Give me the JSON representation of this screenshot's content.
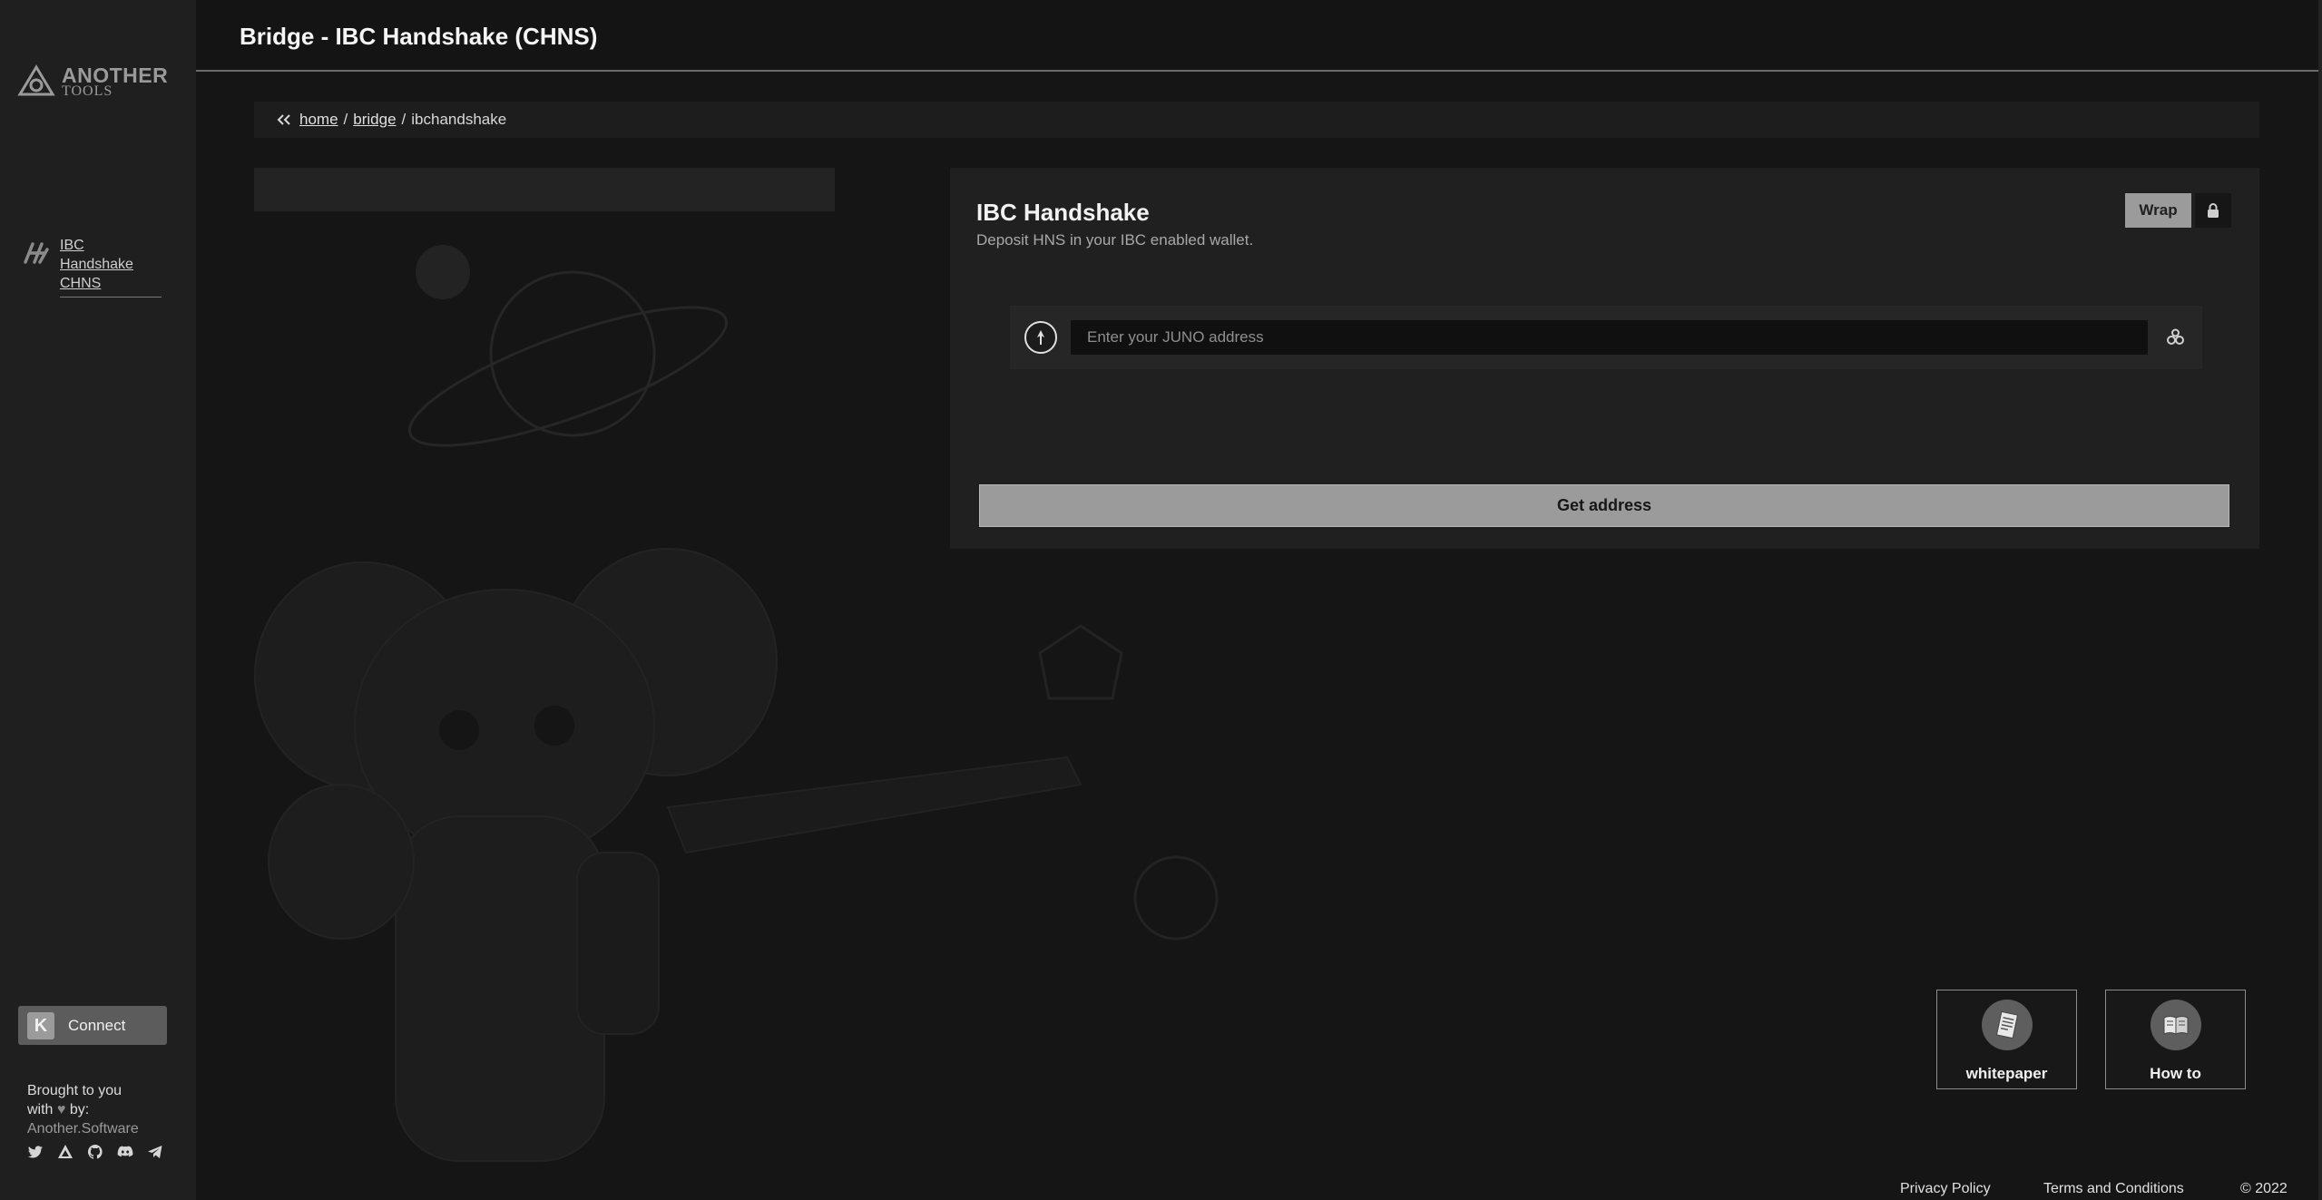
{
  "sidebar": {
    "logo": {
      "main": "ANOTHER",
      "sub": "TOOLS"
    },
    "items": [
      {
        "label": "IBC Handshake CHNS",
        "icon": "handshake-logo-icon"
      }
    ],
    "connect": {
      "badge": "K",
      "label": "Connect"
    },
    "credits": {
      "line1": "Brought to you",
      "line2_prefix": "with",
      "heart": "♥",
      "line2_suffix": "by:",
      "brand": "Another.Software"
    },
    "social": [
      "twitter-icon",
      "another-icon",
      "github-icon",
      "discord-icon",
      "telegram-icon"
    ]
  },
  "header": {
    "title": "Bridge - IBC Handshake (CHNS)"
  },
  "breadcrumb": {
    "home": "home",
    "sep": "/",
    "bridge": "bridge",
    "current": "ibchandshake"
  },
  "card": {
    "title": "IBC Handshake",
    "subtitle": "Deposit HNS in your IBC enabled wallet.",
    "wrap_label": "Wrap",
    "address": {
      "placeholder": "Enter your JUNO address",
      "value": ""
    },
    "get_address_label": "Get address"
  },
  "tiles": [
    {
      "label": "whitepaper",
      "icon": "document-icon"
    },
    {
      "label": "How to",
      "icon": "book-icon"
    }
  ],
  "footer": {
    "privacy": "Privacy Policy",
    "terms": "Terms and Conditions",
    "copyright": "© 2022"
  },
  "colors": {
    "background": "#151515",
    "sidebar": "#1f1f1f",
    "card": "#202020",
    "button": "#9b9b9b"
  }
}
